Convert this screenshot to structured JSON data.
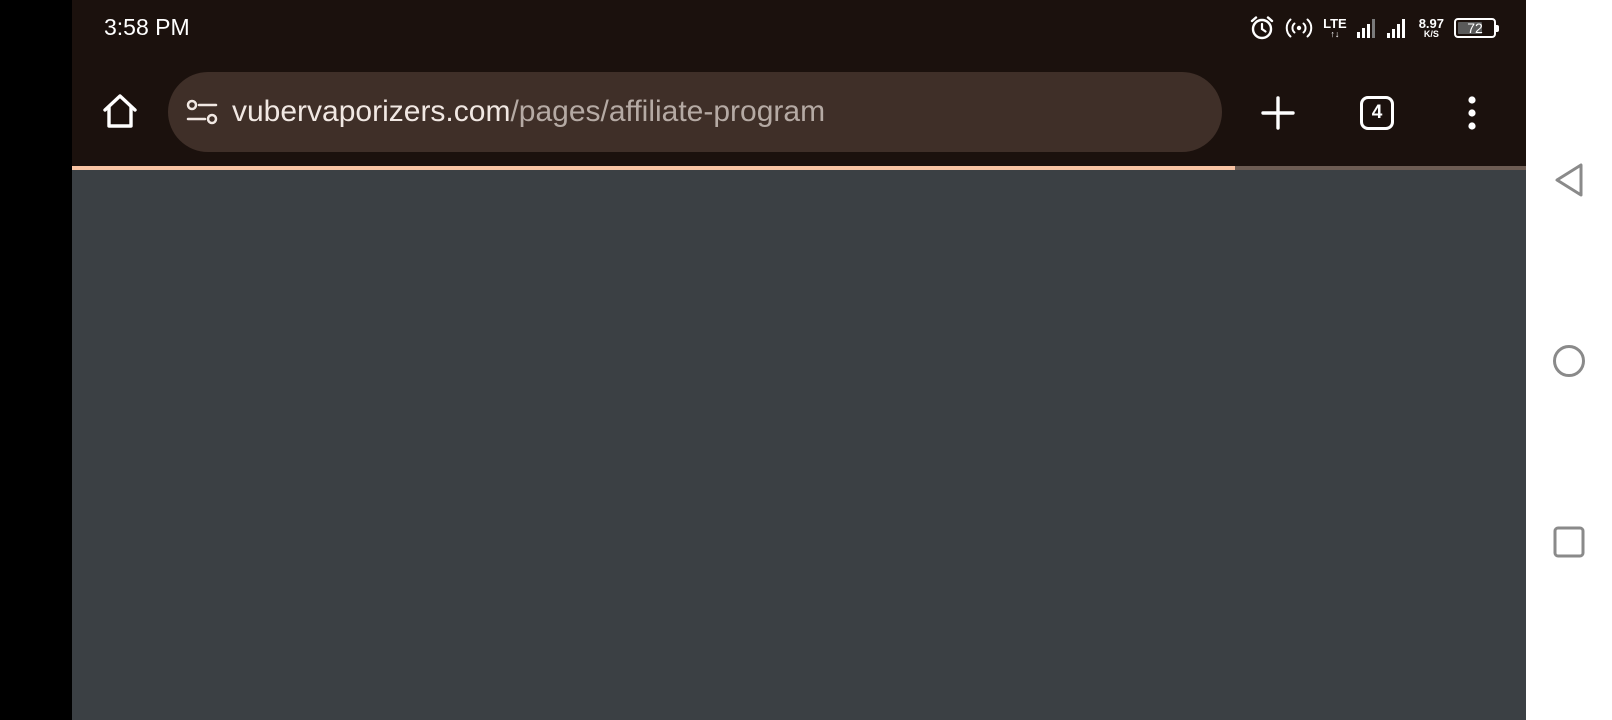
{
  "status_bar": {
    "time": "3:58 PM",
    "network_type": "LTE",
    "data_arrows": "↑↓",
    "net_speed_value": "8.97",
    "net_speed_unit": "K/S",
    "battery_level": "72",
    "battery_fraction": 0.72
  },
  "toolbar": {
    "url_host": "vubervaporizers.com",
    "url_path": "/pages/affiliate-program",
    "tab_count": "4"
  },
  "page_load_progress": 0.8,
  "colors": {
    "toolbar_bg": "#1b110d",
    "omnibox_bg": "#3f2f28",
    "page_bg": "#3b4044",
    "progress_fill": "#f8c3a3",
    "progress_track": "#6d5c53"
  },
  "icons": {
    "home": "home-icon",
    "site_settings": "tune-icon",
    "new_tab": "plus-icon",
    "tab_switcher": "tab-switcher-icon",
    "menu": "more-vertical-icon",
    "alarm": "alarm-icon",
    "hotspot": "hotspot-icon",
    "signal": "signal-icon",
    "nav_back": "triangle-back-icon",
    "nav_home": "circle-home-icon",
    "nav_recents": "square-recents-icon"
  }
}
